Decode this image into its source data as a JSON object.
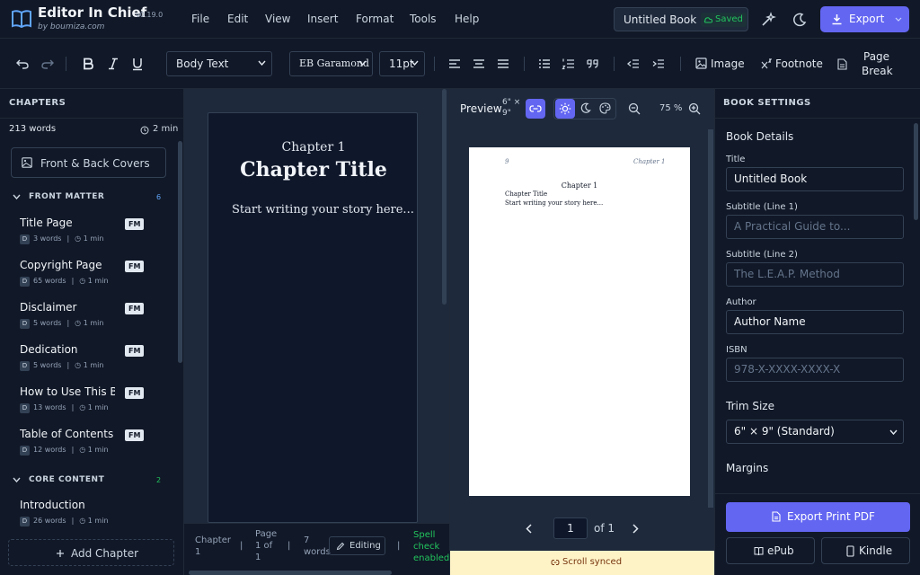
{
  "app": {
    "name": "Editor In Chief",
    "version": "v0.19.0",
    "byline": "by boumiza.com"
  },
  "menu": [
    "File",
    "Edit",
    "View",
    "Insert",
    "Format",
    "Tools",
    "Help"
  ],
  "document": {
    "title": "Untitled Book",
    "save_status": "Saved"
  },
  "header": {
    "export_label": "Export"
  },
  "toolbar": {
    "paragraph_style": "Body Text",
    "font": "EB Garamond",
    "font_size": "11pt",
    "image_label": "Image",
    "footnote_label": "Footnote",
    "page_break_line1": "Page",
    "page_break_line2": "Break"
  },
  "sidebar": {
    "title": "CHAPTERS",
    "word_count": "213 words",
    "read_time": "2 min",
    "covers_label": "Front & Back Covers",
    "front_matter": {
      "label": "FRONT MATTER",
      "count": "6"
    },
    "core_content": {
      "label": "CORE CONTENT",
      "count": "2"
    },
    "chapters": [
      {
        "title": "Title Page",
        "badge": "FM",
        "type": "D",
        "words": "3 words",
        "time": "1 min"
      },
      {
        "title": "Copyright Page",
        "badge": "FM",
        "type": "D",
        "words": "65 words",
        "time": "1 min"
      },
      {
        "title": "Disclaimer",
        "badge": "FM",
        "type": "D",
        "words": "5 words",
        "time": "1 min"
      },
      {
        "title": "Dedication",
        "badge": "FM",
        "type": "D",
        "words": "5 words",
        "time": "1 min"
      },
      {
        "title": "How to Use This Bo",
        "badge": "FM",
        "type": "D",
        "words": "13 words",
        "time": "1 min"
      },
      {
        "title": "Table of Contents",
        "badge": "FM",
        "type": "D",
        "words": "12 words",
        "time": "1 min"
      }
    ],
    "core_chapters": [
      {
        "title": "Introduction",
        "type": "D",
        "words": "26 words",
        "time": "1 min"
      }
    ],
    "add_chapter_label": "Add Chapter"
  },
  "editor": {
    "chapter_label": "Chapter 1",
    "chapter_title": "Chapter Title",
    "body": "Start writing your story here...",
    "status": {
      "chapter_line1": "Chapter",
      "chapter_line2": "1",
      "page_line1": "Page",
      "page_line2": "1 of",
      "page_line3": "1",
      "words_line1": "7",
      "words_line2": "words",
      "mode": "Editing",
      "spell_line1": "Spell",
      "spell_line2": "check",
      "spell_line3": "enabled",
      "sep": "|"
    }
  },
  "preview": {
    "label": "Preview",
    "size_line1": "6\" ×",
    "size_line2": "9\"",
    "zoom": "75 %",
    "page_number": "9",
    "running_head": "Chapter 1",
    "chapter_label": "Chapter 1",
    "chapter_title": "Chapter Title",
    "body": "Start writing your story here...",
    "current_page": "1",
    "of_pages": "of 1",
    "sync_label": "Scroll synced"
  },
  "book_settings": {
    "header": "BOOK SETTINGS",
    "section_details": "Book Details",
    "title_label": "Title",
    "title_value": "Untitled Book",
    "subtitle1_label": "Subtitle (Line 1)",
    "subtitle1_placeholder": "A Practical Guide to...",
    "subtitle2_label": "Subtitle (Line 2)",
    "subtitle2_placeholder": "The L.E.A.P. Method",
    "author_label": "Author",
    "author_value": "Author Name",
    "isbn_label": "ISBN",
    "isbn_placeholder": "978-X-XXXX-XXXX-X",
    "trim_label": "Trim Size",
    "trim_value": "6\" × 9\" (Standard)",
    "margins_label": "Margins",
    "export_pdf_label": "Export Print PDF",
    "epub_label": "ePub",
    "kindle_label": "Kindle"
  },
  "colors": {
    "accent": "#6366f1",
    "saved": "#22c55e",
    "sync_bg": "#fef3c7"
  }
}
